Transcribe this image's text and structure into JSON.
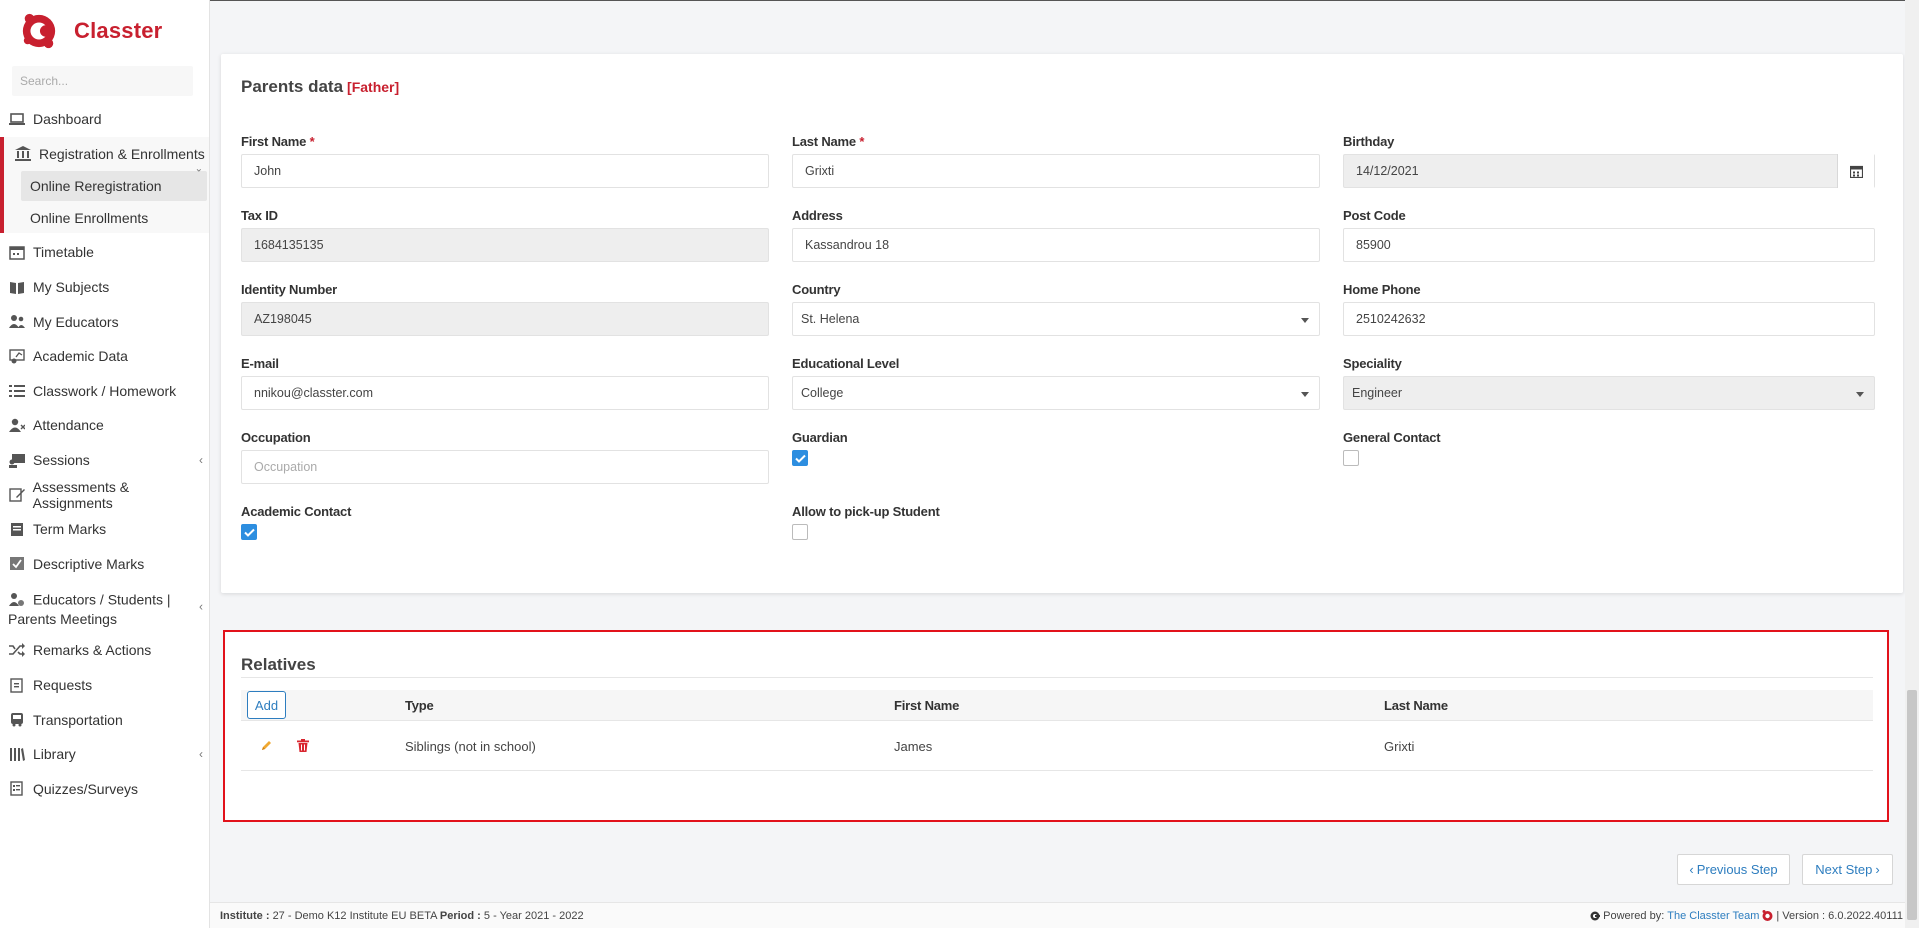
{
  "brand": {
    "name": "Classter"
  },
  "search": {
    "placeholder": "Search..."
  },
  "sidebar": {
    "items_top": [
      {
        "label": "Dashboard",
        "icon": "laptop-icon"
      }
    ],
    "group": {
      "label": "Registration & Enrollments",
      "icon": "bank-icon",
      "subitems": [
        {
          "label": "Online Reregistration",
          "active": true
        },
        {
          "label": "Online Enrollments",
          "active": false
        }
      ]
    },
    "items": [
      {
        "label": "Timetable",
        "icon": "calendar-icon"
      },
      {
        "label": "My Subjects",
        "icon": "book-icon"
      },
      {
        "label": "My Educators",
        "icon": "users-icon"
      },
      {
        "label": "Academic Data",
        "icon": "chart-icon"
      },
      {
        "label": "Classwork / Homework",
        "icon": "list-icon"
      },
      {
        "label": "Attendance",
        "icon": "user-x-icon"
      },
      {
        "label": "Sessions",
        "icon": "presentation-icon"
      },
      {
        "label": "Assessments & Assignments",
        "icon": "edit-icon"
      },
      {
        "label": "Term Marks",
        "icon": "notebook-icon"
      },
      {
        "label": "Descriptive Marks",
        "icon": "checked-doc-icon"
      },
      {
        "label": "Educators / Students | Parents Meetings",
        "icon": "meeting-icon"
      },
      {
        "label": "Remarks & Actions",
        "icon": "shuffle-icon"
      },
      {
        "label": "Requests",
        "icon": "request-icon"
      },
      {
        "label": "Transportation",
        "icon": "bus-icon"
      },
      {
        "label": "Library",
        "icon": "library-icon"
      },
      {
        "label": "Quizzes/Surveys",
        "icon": "quiz-icon"
      }
    ]
  },
  "parents": {
    "title": "Parents data",
    "tag": "[Father]",
    "first_name": {
      "label": "First Name",
      "value": "John"
    },
    "last_name": {
      "label": "Last Name",
      "value": "Grixti"
    },
    "birthday": {
      "label": "Birthday",
      "value": "14/12/2021"
    },
    "tax_id": {
      "label": "Tax ID",
      "value": "1684135135"
    },
    "address": {
      "label": "Address",
      "value": "Kassandrou 18"
    },
    "post_code": {
      "label": "Post Code",
      "value": "85900"
    },
    "identity_number": {
      "label": "Identity Number",
      "value": "AZ198045"
    },
    "country": {
      "label": "Country",
      "value": "St. Helena"
    },
    "home_phone": {
      "label": "Home Phone",
      "value": "2510242632"
    },
    "email": {
      "label": "E-mail",
      "value": "nnikou@classter.com"
    },
    "educational_level": {
      "label": "Educational Level",
      "value": "College"
    },
    "speciality": {
      "label": "Speciality",
      "value": "Engineer"
    },
    "occupation": {
      "label": "Occupation",
      "placeholder": "Occupation"
    },
    "guardian": {
      "label": "Guardian",
      "checked": true
    },
    "general_contact": {
      "label": "General Contact",
      "checked": false
    },
    "academic_contact": {
      "label": "Academic Contact",
      "checked": true
    },
    "allow_pickup": {
      "label": "Allow to pick-up Student",
      "checked": false
    },
    "required_mark": "*"
  },
  "relatives": {
    "title": "Relatives",
    "add_label": "Add",
    "columns": [
      "Type",
      "First Name",
      "Last Name"
    ],
    "rows": [
      {
        "type": "Siblings (not in school)",
        "first_name": "James",
        "last_name": "Grixti"
      }
    ]
  },
  "steps": {
    "previous": "Previous Step",
    "next": "Next Step"
  },
  "footer": {
    "institute_label": "Institute :",
    "institute_value": "27 - Demo K12 Institute EU BETA",
    "period_label": "Period :",
    "period_value": "5 - Year 2021 - 2022",
    "powered_by": "Powered by:",
    "team": "The Classter Team",
    "version": "| Version : 6.0.2022.40111"
  },
  "colors": {
    "brand": "#c8202f",
    "link": "#2d7dbf",
    "checkbox": "#2d8ee0",
    "highlight": "#e2121b"
  }
}
